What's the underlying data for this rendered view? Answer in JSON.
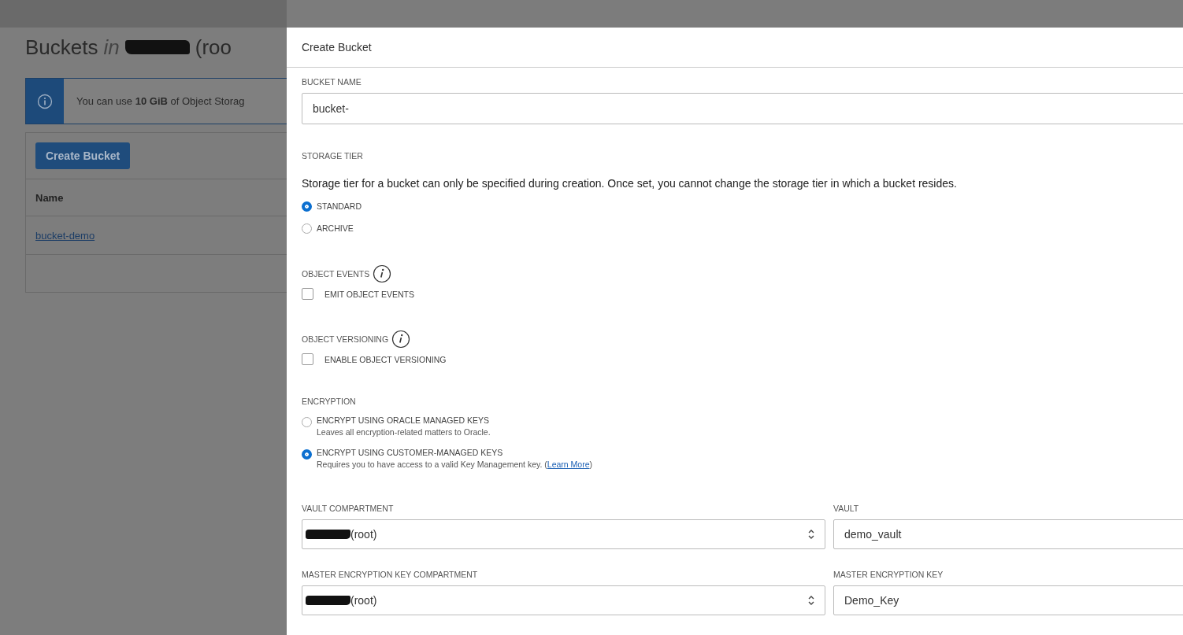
{
  "background_page": {
    "title": {
      "text": "Buckets",
      "qualifier": "in",
      "redacted": true,
      "suffix": "(roo"
    },
    "notice": "You can use **10 GiB** of Object Storag",
    "create_button": "Create Bucket",
    "table": {
      "columns": [
        "Name"
      ],
      "rows": [
        {
          "name": "bucket-demo"
        }
      ]
    }
  },
  "dialog": {
    "title": "Create Bucket",
    "bucket_name": {
      "label": "BUCKET NAME",
      "value": "bucket-"
    },
    "storage_tier": {
      "label": "STORAGE TIER",
      "description": "Storage tier for a bucket can only be specified during creation. Once set, you cannot change the storage tier in which a bucket resides.",
      "options": [
        {
          "label": "STANDARD",
          "selected": true
        },
        {
          "label": "ARCHIVE",
          "selected": false
        }
      ]
    },
    "object_events": {
      "label": "OBJECT EVENTS",
      "option": {
        "label": "EMIT OBJECT EVENTS",
        "checked": false
      }
    },
    "object_versioning": {
      "label": "OBJECT VERSIONING",
      "option": {
        "label": "ENABLE OBJECT VERSIONING",
        "checked": false
      }
    },
    "encryption": {
      "label": "ENCRYPTION",
      "options": [
        {
          "label": "ENCRYPT USING ORACLE MANAGED KEYS",
          "description": "Leaves all encryption-related matters to Oracle.",
          "selected": false
        },
        {
          "label": "ENCRYPT USING CUSTOMER-MANAGED KEYS",
          "description": "Requires you to have access to a valid Key Management key. (",
          "link": "Learn More",
          "description_end": ")",
          "selected": true
        }
      ]
    },
    "key_fields": [
      {
        "kind": "select",
        "label": "VAULT COMPARTMENT",
        "redacted": true,
        "value": "(root)"
      },
      {
        "kind": "input",
        "label": "VAULT",
        "value": "demo_vault"
      },
      {
        "kind": "select",
        "label": "MASTER ENCRYPTION KEY COMPARTMENT",
        "redacted": true,
        "value": "(root)"
      },
      {
        "kind": "input",
        "label": "MASTER ENCRYPTION KEY",
        "value": "Demo_Key"
      }
    ]
  }
}
